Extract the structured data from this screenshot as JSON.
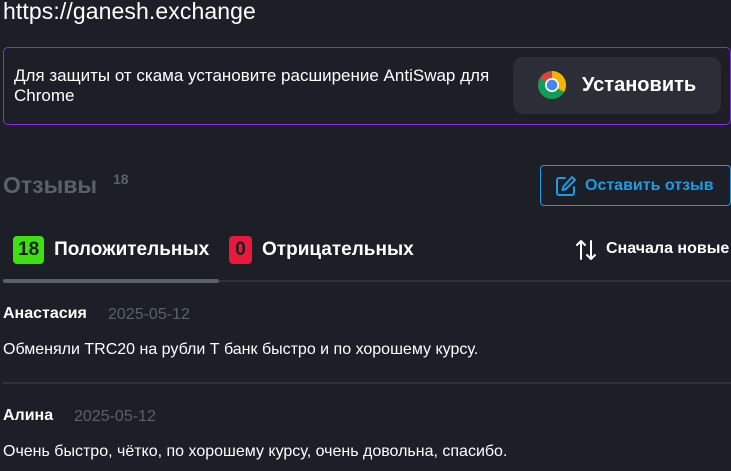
{
  "url": "https://ganesh.exchange",
  "banner": {
    "text": "Для защиты от скама установите расширение AntiSwap для Chrome",
    "button_label": "Установить",
    "button_icon": "chrome-icon",
    "border_color": "#8a2be2"
  },
  "reviews": {
    "title": "Отзывы",
    "count": "18",
    "leave_button": "Оставить отзыв",
    "leave_icon": "edit-icon",
    "accent_color": "#1e9be6"
  },
  "tabs": {
    "positive": {
      "count": "18",
      "label": "Положительных",
      "color": "#3fe012"
    },
    "negative": {
      "count": "0",
      "label": "Отрицательных",
      "color": "#e8193a"
    },
    "active": "positive"
  },
  "sort": {
    "label": "Сначала новые",
    "icon": "sort-arrows-icon"
  },
  "items": [
    {
      "author": "Анастасия",
      "date": "2025-05-12",
      "text": "Обменяли TRC20 на рубли Т банк быстро и по хорошему курсу."
    },
    {
      "author": "Алина",
      "date": "2025-05-12",
      "text": "Очень быстро, чётко, по хорошему курсу, очень довольна, спасибо."
    }
  ]
}
